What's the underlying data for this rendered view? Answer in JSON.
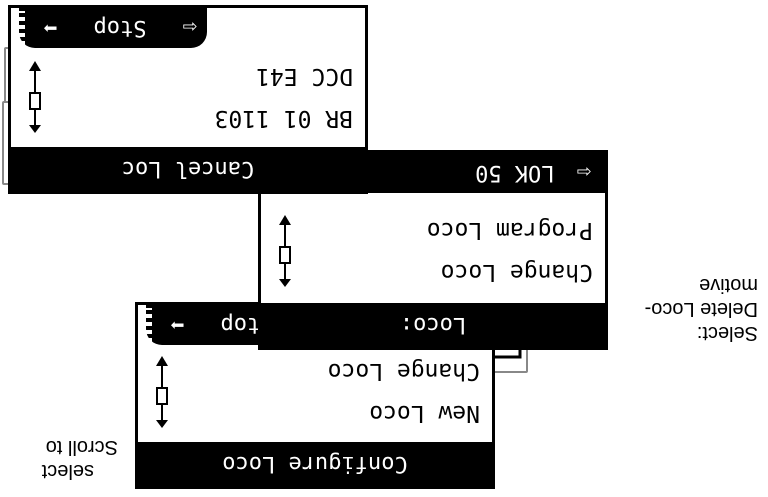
{
  "screen_top": {
    "status": {
      "back_arrow": "⇦",
      "label": "Stop",
      "fwd_arrow": "➡"
    },
    "items": [
      "DCC E41",
      "BR 01 1103"
    ],
    "footer": "Cancel Loc"
  },
  "screen_mid": {
    "status": {
      "back_arrow": "⇦",
      "label": "LOK 50"
    },
    "items": [
      "Program Loco",
      "Change Loco"
    ],
    "footer": "Loco:"
  },
  "screen_bottom": {
    "status": {
      "back_arrow": "⇦",
      "label": "Stop",
      "fwd_arrow": "➡"
    },
    "items": [
      "Change Loco",
      "New Loco"
    ],
    "footer": "Configure Loco"
  },
  "notes": {
    "select_delete": [
      "Select:",
      "Delete Loco-",
      "motive"
    ],
    "scroll_select": [
      "Scroll to",
      "select"
    ]
  }
}
